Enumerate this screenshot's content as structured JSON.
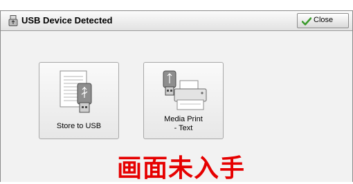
{
  "dialog": {
    "title": "USB Device Detected",
    "close_label": "Close",
    "title_icon": "usb-icon",
    "close_icon": "checkmark-icon"
  },
  "tiles": [
    {
      "label": "Store to USB",
      "icon": "store-to-usb-icon"
    },
    {
      "label_line1": "Media Print",
      "label_line2": "- Text",
      "icon": "media-print-icon"
    }
  ],
  "overlay": {
    "text": "画面未入手"
  }
}
